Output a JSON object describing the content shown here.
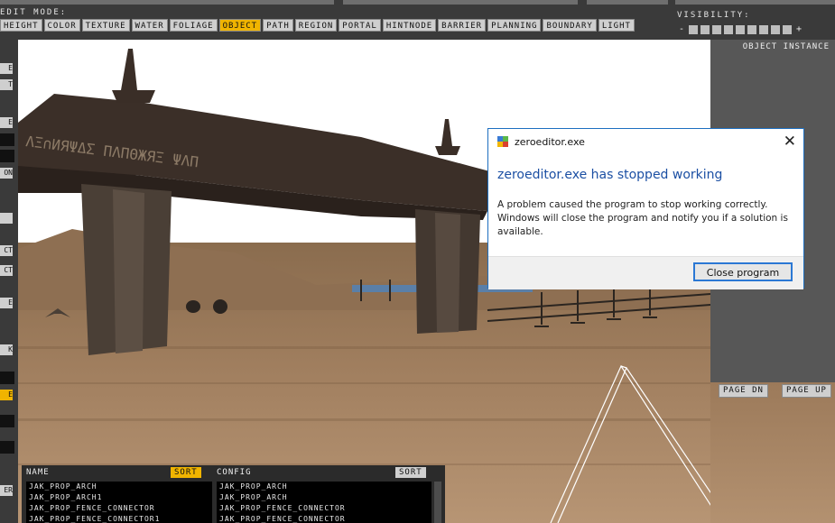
{
  "toolbar": {
    "edit_mode_label": "EDIT MODE:",
    "modes": [
      {
        "label": "HEIGHT"
      },
      {
        "label": "COLOR"
      },
      {
        "label": "TEXTURE"
      },
      {
        "label": "WATER"
      },
      {
        "label": "FOLIAGE"
      },
      {
        "label": "OBJECT",
        "active": true
      },
      {
        "label": "PATH"
      },
      {
        "label": "REGION"
      },
      {
        "label": "PORTAL"
      },
      {
        "label": "HINTNODE"
      },
      {
        "label": "BARRIER"
      },
      {
        "label": "PLANNING"
      },
      {
        "label": "BOUNDARY"
      },
      {
        "label": "LIGHT"
      }
    ],
    "visibility_label": "VISIBILITY:",
    "visibility_minus": "-",
    "visibility_plus": "+",
    "visibility_level": 0
  },
  "left_toolbar": {
    "labels": [
      "E",
      "T",
      "E",
      "ON",
      "CT",
      "CT",
      "E",
      "K",
      "E",
      "ER"
    ]
  },
  "right_panel": {
    "title": "OBJECT INSTANCE",
    "page_down": "PAGE DN",
    "page_up": "PAGE UP"
  },
  "name_list": {
    "header": "NAME",
    "sort": "SORT",
    "items": [
      "JAK_PROP_ARCH",
      "JAK_PROP_ARCH1",
      "JAK_PROP_FENCE_CONNECTOR",
      "JAK_PROP_FENCE_CONNECTOR1"
    ]
  },
  "config_list": {
    "header": "CONFIG",
    "sort": "SORT",
    "items": [
      "JAK_PROP_ARCH",
      "JAK_PROP_ARCH",
      "JAK_PROP_FENCE_CONNECTOR",
      "JAK_PROP_FENCE_CONNECTOR"
    ]
  },
  "viewport": {
    "arch_inscription": "ΛΞ∩ИЯΨΔΣ ΠΛΠΘЖЯΞ ΨΛΠ"
  },
  "dialog": {
    "title": "zeroeditor.exe",
    "heading": "zeroeditor.exe has stopped working",
    "message": "A problem caused the program to stop working correctly. Windows will close the program and notify you if a solution is available.",
    "button": "Close program"
  },
  "colors": {
    "accent": "#f0b400",
    "panel": "#3a3a3a",
    "dialog_heading": "#1b4fa3",
    "dialog_button_border": "#2b78d4"
  }
}
